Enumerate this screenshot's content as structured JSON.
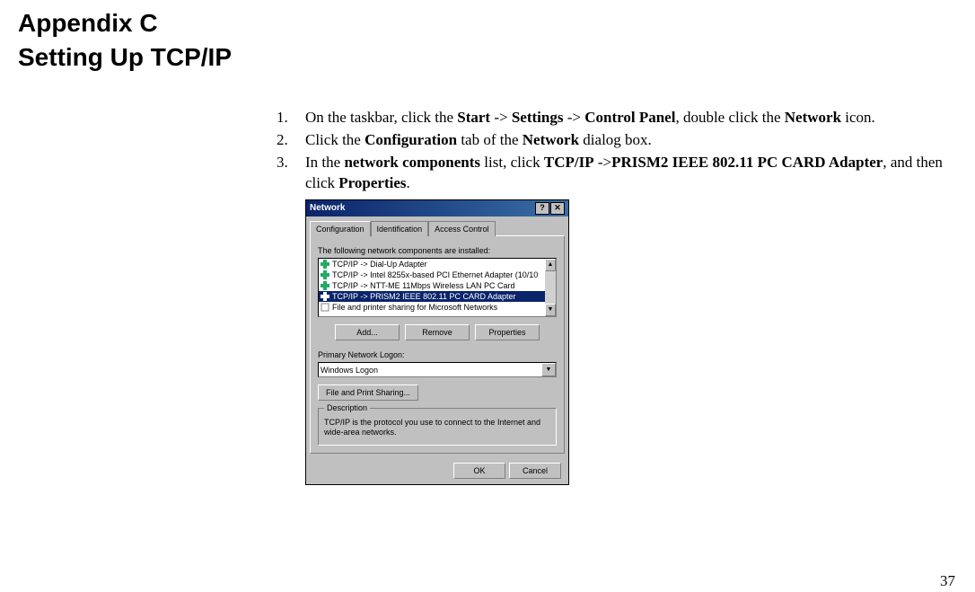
{
  "heading1": "Appendix C",
  "heading2": "Setting Up TCP/IP",
  "steps": {
    "1": {
      "pre": "On the taskbar, click the ",
      "b1": "Start",
      "a1": " -> ",
      "b2": "Settings",
      "a2": " -> ",
      "b3": "Control Panel",
      "a3": ", double click the ",
      "b4": "Network",
      "post": " icon."
    },
    "2": {
      "pre": "Click the ",
      "b1": "Configuration",
      "a1": " tab of the ",
      "b2": "Network",
      "post": " dialog box."
    },
    "3": {
      "pre": "In the ",
      "b1": "network components",
      "a1": " list, click ",
      "b2": "TCP/IP",
      "a2": " ->",
      "b3": "PRISM2 IEEE 802.11 PC CARD Adapter",
      "a3": ", and then click ",
      "b4": "Properties",
      "post": "."
    }
  },
  "dialog": {
    "title": "Network",
    "help_btn": "?",
    "close_btn": "✕",
    "tabs": {
      "0": "Configuration",
      "1": "Identification",
      "2": "Access Control"
    },
    "components_label": "The following network components are installed:",
    "list": {
      "0": "TCP/IP -> Dial-Up Adapter",
      "1": "TCP/IP -> Intel 8255x-based PCI Ethernet Adapter (10/10",
      "2": "TCP/IP -> NTT-ME 11Mbps Wireless LAN PC Card",
      "3": "TCP/IP -> PRISM2 IEEE 802.11 PC CARD Adapter",
      "4": "File and printer sharing for Microsoft Networks"
    },
    "btn_add": "Add...",
    "btn_remove": "Remove",
    "btn_properties": "Properties",
    "logon_label": "Primary Network Logon:",
    "logon_value": "Windows Logon",
    "fps_btn": "File and Print Sharing...",
    "desc_legend": "Description",
    "desc_text": "TCP/IP is the protocol you use to connect to the Internet and wide-area networks.",
    "btn_ok": "OK",
    "btn_cancel": "Cancel"
  },
  "page_number": "37"
}
